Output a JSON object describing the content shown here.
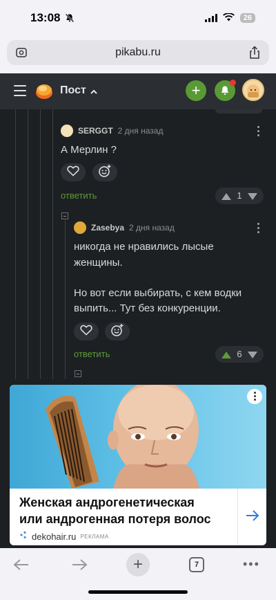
{
  "status_bar": {
    "time": "13:08",
    "battery": "26"
  },
  "browser": {
    "url": "pikabu.ru",
    "tab_count": "7"
  },
  "header": {
    "title": "Пост",
    "accent_color": "#5a9a35"
  },
  "comments": [
    {
      "username": "SERGGT",
      "date": "2 дня назад",
      "text": "А Мерлин ?",
      "reply_label": "ответить",
      "rating": "1"
    },
    {
      "username": "Zasebya",
      "date": "2 дня назад",
      "text_line1": "никогда не нравились лысые",
      "text_line2": "женщины.",
      "text_line3": "Но вот если выбирать, с кем водки",
      "text_line4": "выпить... Тут без конкуренции.",
      "reply_label": "ответить",
      "rating": "6"
    }
  ],
  "ad": {
    "title_line1": "Женская андрогенетическая",
    "title_line2": "или андрогенная потеря волос",
    "domain": "dekohair.ru",
    "badge": "РЕКЛАМА"
  },
  "icons": {
    "hamburger": "menu-icon",
    "plus": "plus-icon",
    "bell": "bell-icon",
    "heart": "heart-icon",
    "emoji": "emoji-add-icon",
    "kebab": "more-vertical-icon",
    "arrow": "arrow-right-icon"
  }
}
